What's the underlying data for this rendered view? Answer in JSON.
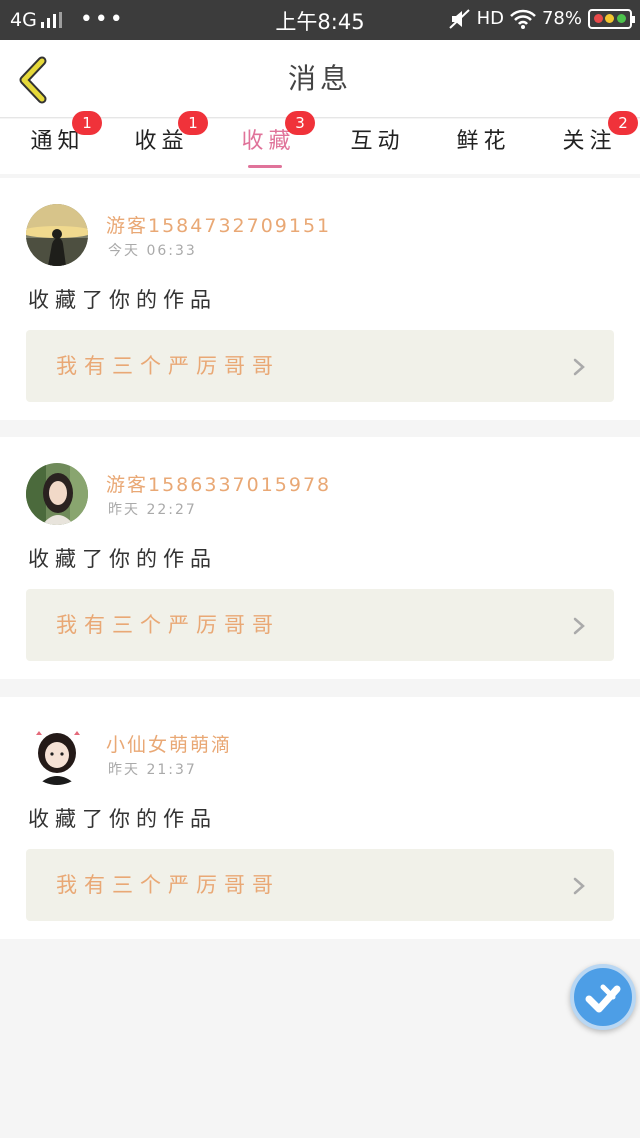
{
  "status_bar": {
    "network": "4G",
    "more_indicator": "•••",
    "time": "上午8:45",
    "hd": "HD",
    "battery": "78%",
    "icons": [
      "signal-icon",
      "mute-icon",
      "wifi-icon",
      "battery-icon"
    ]
  },
  "header": {
    "title": "消息",
    "back_icon": "chevron-left-icon",
    "accent_color": "#e6d93a"
  },
  "tabs": [
    {
      "label": "通知",
      "badge": "1",
      "active": false
    },
    {
      "label": "收益",
      "badge": "1",
      "active": false
    },
    {
      "label": "收藏",
      "badge": "3",
      "active": true
    },
    {
      "label": "互动",
      "badge": "",
      "active": false
    },
    {
      "label": "鲜花",
      "badge": "",
      "active": false
    },
    {
      "label": "关注",
      "badge": "2",
      "active": false
    }
  ],
  "messages": [
    {
      "user": "游客15847327091​51",
      "time": "今天 06:33",
      "action": "收藏了你的作品",
      "work_title": "我有三个严厉哥哥"
    },
    {
      "user": "游客15863370159​78",
      "time": "昨天 22:27",
      "action": "收藏了你的作品",
      "work_title": "我有三个严厉哥哥"
    },
    {
      "user": "小仙女萌萌滴",
      "time": "昨天 21:37",
      "action": "收藏了你的作品",
      "work_title": "我有三个严厉哥哥"
    }
  ],
  "colors": {
    "tab_active": "#e0739a",
    "badge": "#f0323a",
    "username": "#e9a875",
    "work_card_bg": "#f1f1e9",
    "fab": "#4d9ee6"
  },
  "fab_icon": "shortcut-icon"
}
